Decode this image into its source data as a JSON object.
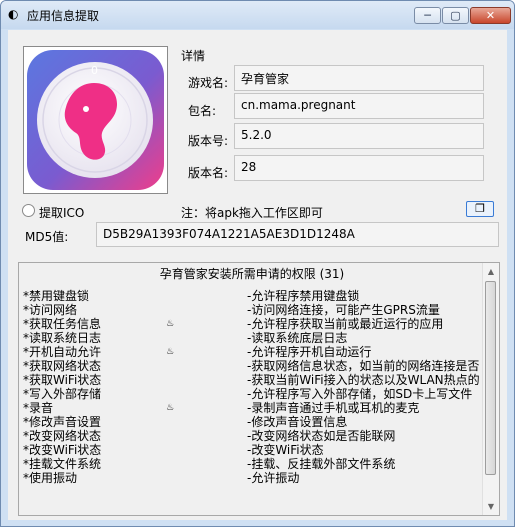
{
  "window": {
    "title": "应用信息提取",
    "min": "─",
    "max": "▢",
    "close": "✕"
  },
  "details": {
    "group_label": "详情",
    "fields": [
      {
        "label": "游戏名:",
        "value": "孕育管家"
      },
      {
        "label": "包名:",
        "value": "cn.mama.pregnant"
      },
      {
        "label": "版本号:",
        "value": "5.2.0"
      },
      {
        "label": "版本名:",
        "value": "28"
      }
    ]
  },
  "extract_ico_label": "提取ICO",
  "note": "注：将apk拖入工作区即可",
  "md5": {
    "label": "MD5值:",
    "value": "D5B29A1393F074A1221A5AE3D1D1248A"
  },
  "permissions": {
    "title": "孕育管家安装所需申请的权限 (31)",
    "rows": [
      {
        "name": "*禁用键盘锁",
        "flag": "",
        "desc": "-允许程序禁用键盘锁"
      },
      {
        "name": "*访问网络",
        "flag": "",
        "desc": "-访问网络连接，可能产生GPRS流量"
      },
      {
        "name": "*获取任务信息",
        "flag": "♨",
        "desc": "-允许程序获取当前或最近运行的应用"
      },
      {
        "name": "*读取系统日志",
        "flag": "",
        "desc": "-读取系统底层日志"
      },
      {
        "name": "*开机自动允许",
        "flag": "♨",
        "desc": "-允许程序开机自动运行"
      },
      {
        "name": "*获取网络状态",
        "flag": "",
        "desc": "-获取网络信息状态，如当前的网络连接是否"
      },
      {
        "name": "*获取WiFi状态",
        "flag": "",
        "desc": "-获取当前WiFi接入的状态以及WLAN热点的"
      },
      {
        "name": "*写入外部存储",
        "flag": "",
        "desc": "-允许程序写入外部存储，如SD卡上写文件"
      },
      {
        "name": "*录音",
        "flag": "♨",
        "desc": "-录制声音通过手机或耳机的麦克"
      },
      {
        "name": "*修改声音设置",
        "flag": "",
        "desc": "-修改声音设置信息"
      },
      {
        "name": "*改变网络状态",
        "flag": "",
        "desc": "-改变网络状态如是否能联网"
      },
      {
        "name": "*改变WiFi状态",
        "flag": "",
        "desc": "-改变WiFi状态"
      },
      {
        "name": "*挂载文件系统",
        "flag": "",
        "desc": "-挂载、反挂载外部文件系统"
      },
      {
        "name": "*使用振动",
        "flag": "",
        "desc": "-允许振动"
      }
    ]
  },
  "colors": {
    "title_bg": "#c6d9ef",
    "icon_blue": "#5a73d6",
    "icon_pink": "#ef3d8a"
  }
}
